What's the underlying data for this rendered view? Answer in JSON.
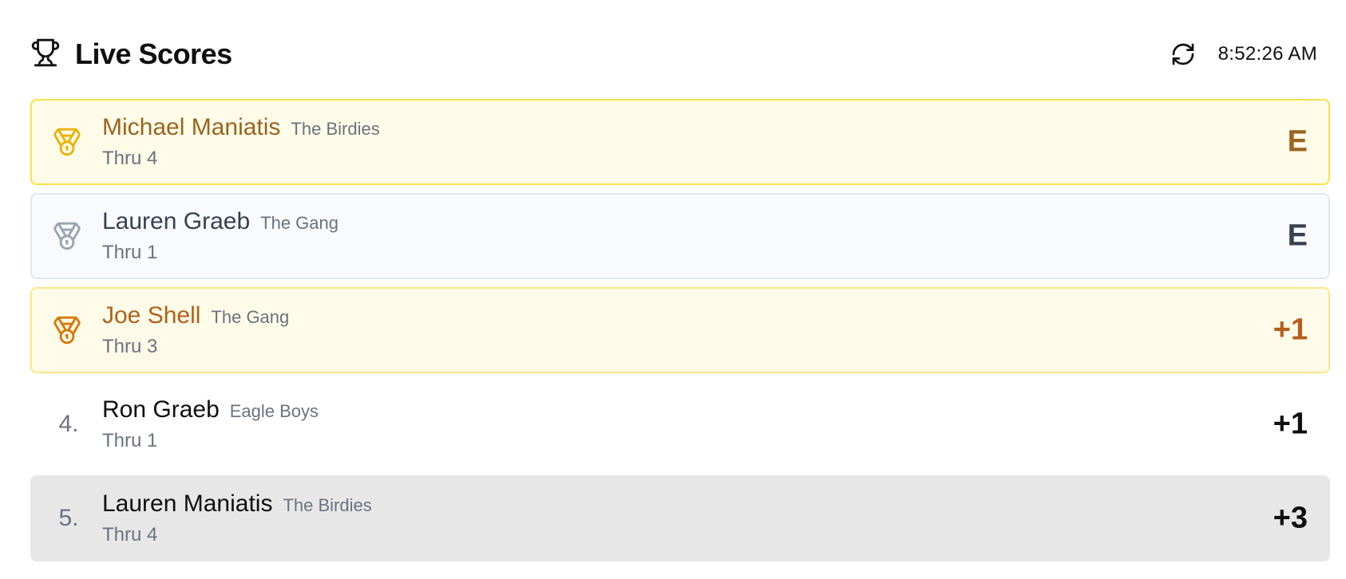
{
  "header": {
    "title": "Live Scores",
    "title_icon": "trophy-icon",
    "refresh_icon": "refresh-icon",
    "time": "8:52:26 AM"
  },
  "colors": {
    "gold": "#eab308",
    "gold_text": "#9a6420",
    "silver": "#9ca3af",
    "silver_text": "#374151",
    "bronze": "#d97706",
    "bronze_text": "#b45f1b"
  },
  "players": [
    {
      "rank_icon": "gold-medal-icon",
      "name": "Michael Maniatis",
      "team": "The Birdies",
      "thru": "Thru 4",
      "score": "E"
    },
    {
      "rank_icon": "silver-medal-icon",
      "name": "Lauren Graeb",
      "team": "The Gang",
      "thru": "Thru 1",
      "score": "E"
    },
    {
      "rank_icon": "bronze-medal-icon",
      "name": "Joe Shell",
      "team": "The Gang",
      "thru": "Thru 3",
      "score": "+1"
    },
    {
      "rank": "4.",
      "name": "Ron Graeb",
      "team": "Eagle Boys",
      "thru": "Thru 1",
      "score": "+1"
    },
    {
      "rank": "5.",
      "name": "Lauren Maniatis",
      "team": "The Birdies",
      "thru": "Thru 4",
      "score": "+3"
    }
  ]
}
